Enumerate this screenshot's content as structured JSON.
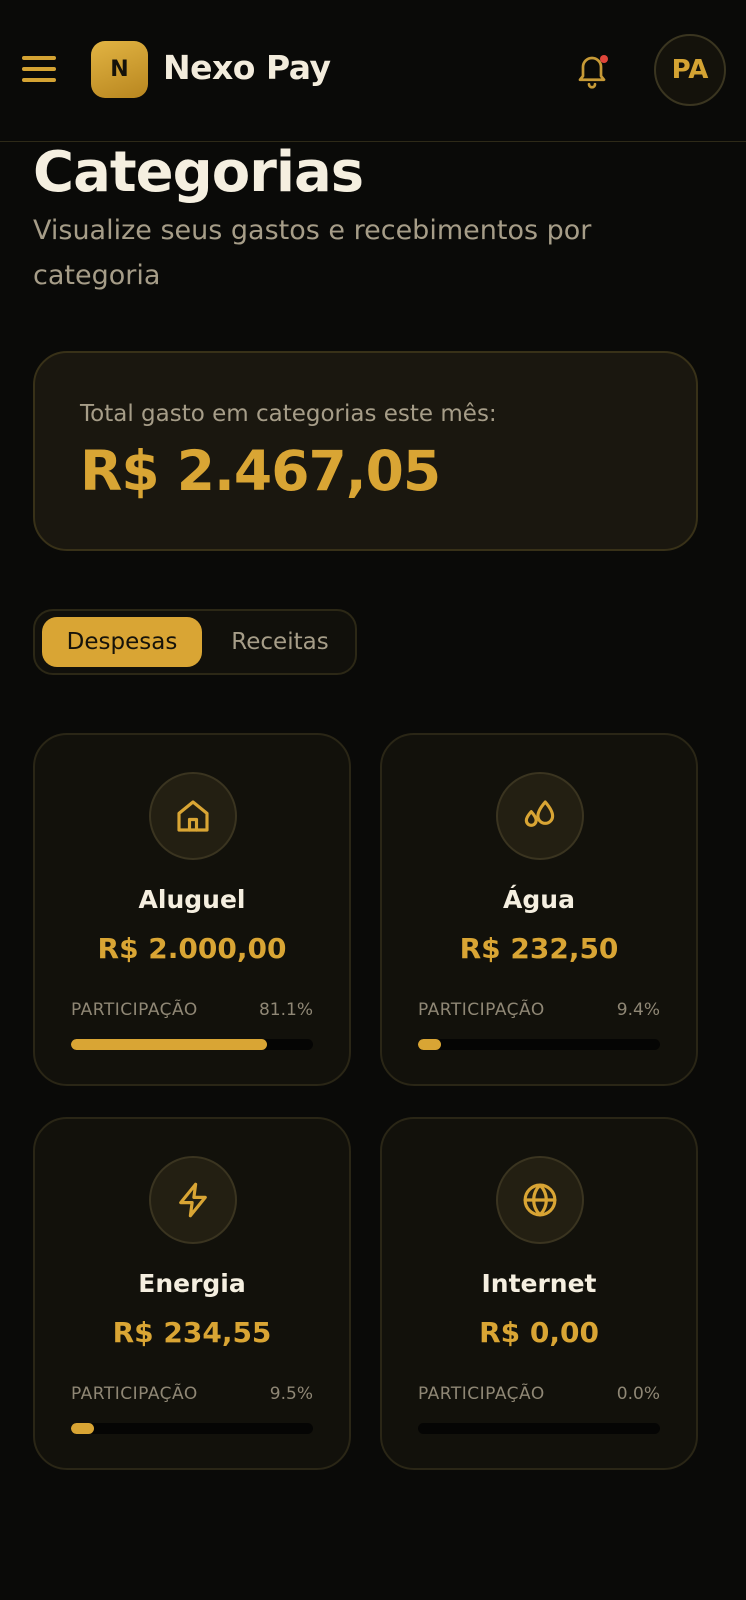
{
  "header": {
    "logo_letter": "N",
    "app_name": "Nexo Pay",
    "avatar_initials": "PA"
  },
  "page": {
    "title": "Categorias",
    "subtitle": "Visualize seus gastos e recebimentos por categoria"
  },
  "summary": {
    "label": "Total gasto em categorias este mês:",
    "value": "R$ 2.467,05"
  },
  "tabs": {
    "expenses": "Despesas",
    "income": "Receitas",
    "active": "expenses"
  },
  "colors": {
    "accent": "#d9a534",
    "background": "#0a0a08",
    "notification_dot": "#e0463a"
  },
  "categories": [
    {
      "name": "Aluguel",
      "amount": "R$ 2.000,00",
      "share_label": "PARTICIPAÇÃO",
      "share_text": "81.1%",
      "share": 0.811,
      "icon": "house-icon"
    },
    {
      "name": "Água",
      "amount": "R$ 232,50",
      "share_label": "PARTICIPAÇÃO",
      "share_text": "9.4%",
      "share": 0.094,
      "icon": "water-drops-icon"
    },
    {
      "name": "Energia",
      "amount": "R$ 234,55",
      "share_label": "PARTICIPAÇÃO",
      "share_text": "9.5%",
      "share": 0.095,
      "icon": "lightning-icon"
    },
    {
      "name": "Internet",
      "amount": "R$ 0,00",
      "share_label": "PARTICIPAÇÃO",
      "share_text": "0.0%",
      "share": 0.0,
      "icon": "globe-icon"
    }
  ]
}
